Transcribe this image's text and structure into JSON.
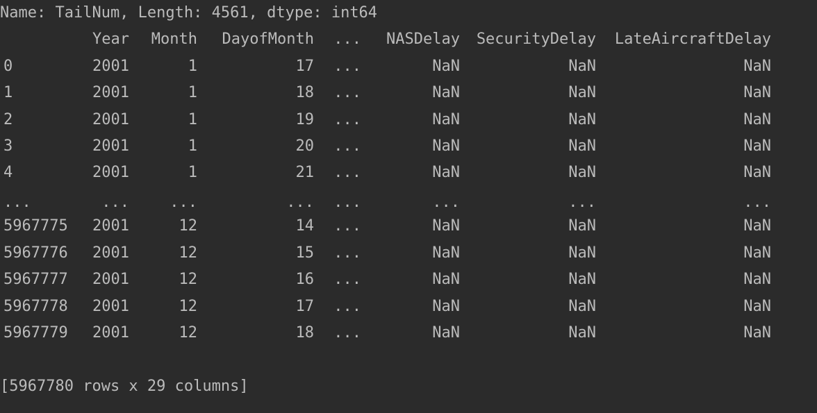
{
  "console": {
    "series_footer": "Name: TailNum, Length: 4561, dtype: int64",
    "dataframe": {
      "columns": [
        "",
        "Year",
        "Month",
        "DayofMonth",
        "...",
        "NASDelay",
        "SecurityDelay",
        "LateAircraftDelay"
      ],
      "rows": [
        [
          "0",
          "2001",
          "1",
          "17",
          "...",
          "NaN",
          "NaN",
          "NaN"
        ],
        [
          "1",
          "2001",
          "1",
          "18",
          "...",
          "NaN",
          "NaN",
          "NaN"
        ],
        [
          "2",
          "2001",
          "1",
          "19",
          "...",
          "NaN",
          "NaN",
          "NaN"
        ],
        [
          "3",
          "2001",
          "1",
          "20",
          "...",
          "NaN",
          "NaN",
          "NaN"
        ],
        [
          "4",
          "2001",
          "1",
          "21",
          "...",
          "NaN",
          "NaN",
          "NaN"
        ],
        [
          "...",
          "...",
          "...",
          "...",
          "...",
          "...",
          "...",
          "..."
        ],
        [
          "5967775",
          "2001",
          "12",
          "14",
          "...",
          "NaN",
          "NaN",
          "NaN"
        ],
        [
          "5967776",
          "2001",
          "12",
          "15",
          "...",
          "NaN",
          "NaN",
          "NaN"
        ],
        [
          "5967777",
          "2001",
          "12",
          "16",
          "...",
          "NaN",
          "NaN",
          "NaN"
        ],
        [
          "5967778",
          "2001",
          "12",
          "17",
          "...",
          "NaN",
          "NaN",
          "NaN"
        ],
        [
          "5967779",
          "2001",
          "12",
          "18",
          "...",
          "NaN",
          "NaN",
          "NaN"
        ]
      ],
      "summary": "[5967780 rows x 29 columns]"
    },
    "colors": {
      "background": "#2b2b2b",
      "text": "#bbbbbb"
    }
  }
}
